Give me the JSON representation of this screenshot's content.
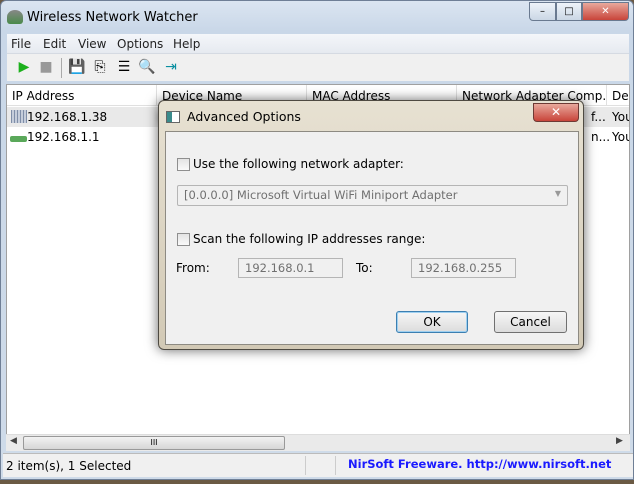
{
  "window": {
    "title": "Wireless Network Watcher",
    "min": "–",
    "max": "□",
    "close": "✕"
  },
  "menu": [
    "File",
    "Edit",
    "View",
    "Options",
    "Help"
  ],
  "toolbar": {
    "start": "▶",
    "stop": "■",
    "save": "💾",
    "copy": "⎘",
    "properties": "☰",
    "html_report": "🔍",
    "exit": "⇥"
  },
  "columns": [
    "IP Address",
    "Device Name",
    "MAC Address",
    "Network Adapter Comp...",
    "Device Information"
  ],
  "rows": [
    {
      "ip": "192.168.1.38",
      "adapter_tail": "f...",
      "info": "You"
    },
    {
      "ip": "192.168.1.1",
      "adapter_tail": "n...",
      "info": "You"
    }
  ],
  "scroll_grip": "III",
  "status": {
    "count": "2 item(s), 1 Selected",
    "credit": "NirSoft Freeware.  http://www.nirsoft.net"
  },
  "dialog": {
    "title": "Advanced Options",
    "use_adapter_label": "Use the following network adapter:",
    "use_adapter_checked": false,
    "adapter_value": "[0.0.0.0]  Microsoft Virtual WiFi Miniport Adapter",
    "scan_range_label": "Scan the following IP addresses range:",
    "scan_range_checked": false,
    "from_label": "From:",
    "from_value": "192.168.0.1",
    "to_label": "To:",
    "to_value": "192.168.0.255",
    "ok": "OK",
    "cancel": "Cancel"
  },
  "colors": {
    "link": "#1a1aff",
    "close_red": "#c8443a",
    "play_green": "#1cb01c"
  }
}
